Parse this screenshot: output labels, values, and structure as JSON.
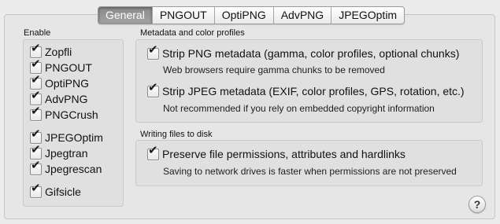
{
  "tabs": [
    {
      "label": "General",
      "selected": true
    },
    {
      "label": "PNGOUT",
      "selected": false
    },
    {
      "label": "OptiPNG",
      "selected": false
    },
    {
      "label": "AdvPNG",
      "selected": false
    },
    {
      "label": "JPEGOptim",
      "selected": false
    }
  ],
  "enable": {
    "label": "Enable",
    "items": [
      {
        "label": "Zopfli",
        "checked": true
      },
      {
        "label": "PNGOUT",
        "checked": true
      },
      {
        "label": "OptiPNG",
        "checked": true
      },
      {
        "label": "AdvPNG",
        "checked": true
      },
      {
        "label": "PNGCrush",
        "checked": true
      },
      {
        "label": "JPEGOptim",
        "checked": true
      },
      {
        "label": "Jpegtran",
        "checked": true
      },
      {
        "label": "Jpegrescan",
        "checked": true
      },
      {
        "label": "Gifsicle",
        "checked": true
      }
    ]
  },
  "metadata": {
    "label": "Metadata and color profiles",
    "strip_png": {
      "label": "Strip PNG metadata (gamma, color profiles, optional chunks)",
      "checked": true,
      "note": "Web browsers require gamma chunks to be removed"
    },
    "strip_jpeg": {
      "label": "Strip JPEG metadata (EXIF, color profiles, GPS, rotation, etc.)",
      "checked": true,
      "note": "Not recommended if you rely on embedded copyright information"
    }
  },
  "writing": {
    "label": "Writing files to disk",
    "preserve": {
      "label": "Preserve file permissions, attributes and hardlinks",
      "checked": true,
      "note": "Saving to network drives is faster when permissions are not preserved"
    }
  },
  "help": {
    "symbol": "?"
  },
  "checkmark": "✔"
}
